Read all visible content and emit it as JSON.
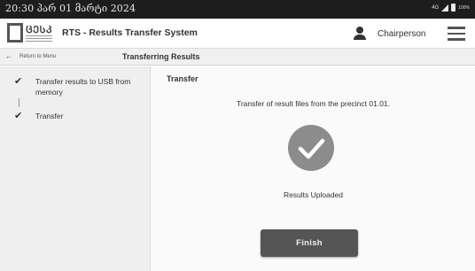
{
  "status_bar": {
    "time": "20:30 პარ 01 მარტი 2024",
    "network": "4G",
    "battery": "100%"
  },
  "app": {
    "logo_text": "ᲪᲔᲡᲙ",
    "title": "RTS - Results Transfer System",
    "user_icon": "person-icon",
    "role": "Chairperson",
    "menu_icon": "hamburger-menu-icon"
  },
  "nav": {
    "back_label": "Return to Menu",
    "page_title": "Transferring Results"
  },
  "steps": [
    {
      "label": "Transfer results to USB from memory",
      "done": true
    },
    {
      "label": "Transfer",
      "done": true
    }
  ],
  "main": {
    "section_title": "Transfer",
    "message": "Transfer of result files from the precinct 01.01.",
    "result_icon": "checkmark-circle-icon",
    "result_text": "Results Uploaded",
    "finish_label": "Finish"
  },
  "colors": {
    "status_bar": "#1d1d1d",
    "button": "#555555",
    "check_circle": "#8c8c8c",
    "panel": "#efefef"
  }
}
